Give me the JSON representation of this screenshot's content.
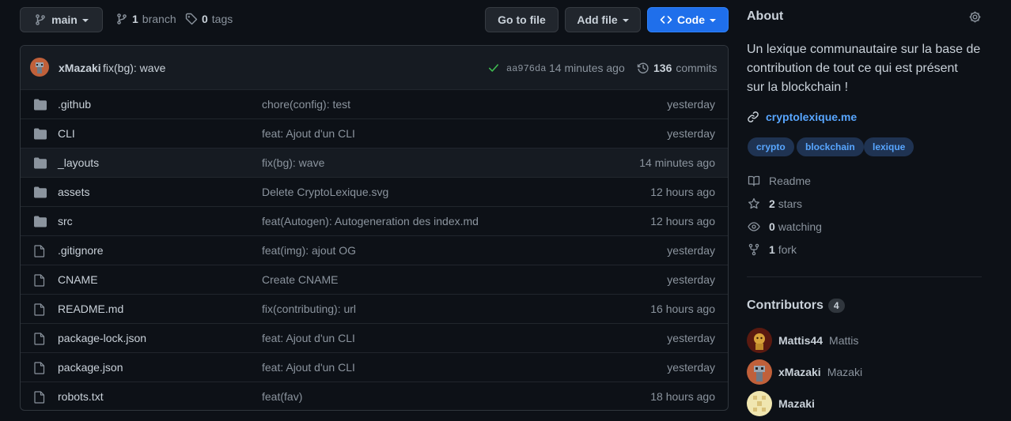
{
  "branch_bar": {
    "branch_name": "main",
    "branch_count": "1",
    "branch_label": "branch",
    "tags_count": "0",
    "tags_label": "tags",
    "go_to_file": "Go to file",
    "add_file": "Add file",
    "code": "Code"
  },
  "commit": {
    "author": "xMazaki",
    "message": "fix(bg): wave",
    "sha": "aa976da",
    "time": "14 minutes ago",
    "commits_count": "136",
    "commits_label": "commits"
  },
  "files": [
    {
      "type": "dir",
      "name": ".github",
      "message": "chore(config): test",
      "age": "yesterday"
    },
    {
      "type": "dir",
      "name": "CLI",
      "message": "feat: Ajout d'un CLI",
      "age": "yesterday"
    },
    {
      "type": "dir",
      "name": "_layouts",
      "message": "fix(bg): wave",
      "age": "14 minutes ago"
    },
    {
      "type": "dir",
      "name": "assets",
      "message": "Delete CryptoLexique.svg",
      "age": "12 hours ago"
    },
    {
      "type": "dir",
      "name": "src",
      "message": "feat(Autogen): Autogeneration des index.md",
      "age": "12 hours ago"
    },
    {
      "type": "file",
      "name": ".gitignore",
      "message": "feat(img): ajout OG",
      "age": "yesterday"
    },
    {
      "type": "file",
      "name": "CNAME",
      "message": "Create CNAME",
      "age": "yesterday"
    },
    {
      "type": "file",
      "name": "README.md",
      "message": "fix(contributing): url",
      "age": "16 hours ago"
    },
    {
      "type": "file",
      "name": "package-lock.json",
      "message": "feat: Ajout d'un CLI",
      "age": "yesterday"
    },
    {
      "type": "file",
      "name": "package.json",
      "message": "feat: Ajout d'un CLI",
      "age": "yesterday"
    },
    {
      "type": "file",
      "name": "robots.txt",
      "message": "feat(fav)",
      "age": "18 hours ago"
    }
  ],
  "about": {
    "title": "About",
    "description_lines": [
      "Un lexique communautaire sur la base de",
      "contribution de tout ce qui est présent",
      "sur la blockchain !"
    ],
    "website": "cryptolexique.me",
    "topics": [
      "crypto",
      "blockchain",
      "lexique"
    ],
    "readme": "Readme",
    "stars_count": "2",
    "stars_label": "stars",
    "watching_count": "0",
    "watching_label": "watching",
    "fork_count": "1",
    "fork_label": "fork"
  },
  "contributors": {
    "title": "Contributors",
    "count": "4",
    "list": [
      {
        "login": "Mattis44",
        "name": "Mattis"
      },
      {
        "login": "xMazaki",
        "name": "Mazaki"
      },
      {
        "login": "Mazaki",
        "name": ""
      }
    ]
  },
  "colors": {
    "background": "#0d1117",
    "accent_blue": "#1f6feb",
    "link_blue": "#58a6ff",
    "check_green": "#3fb950"
  }
}
